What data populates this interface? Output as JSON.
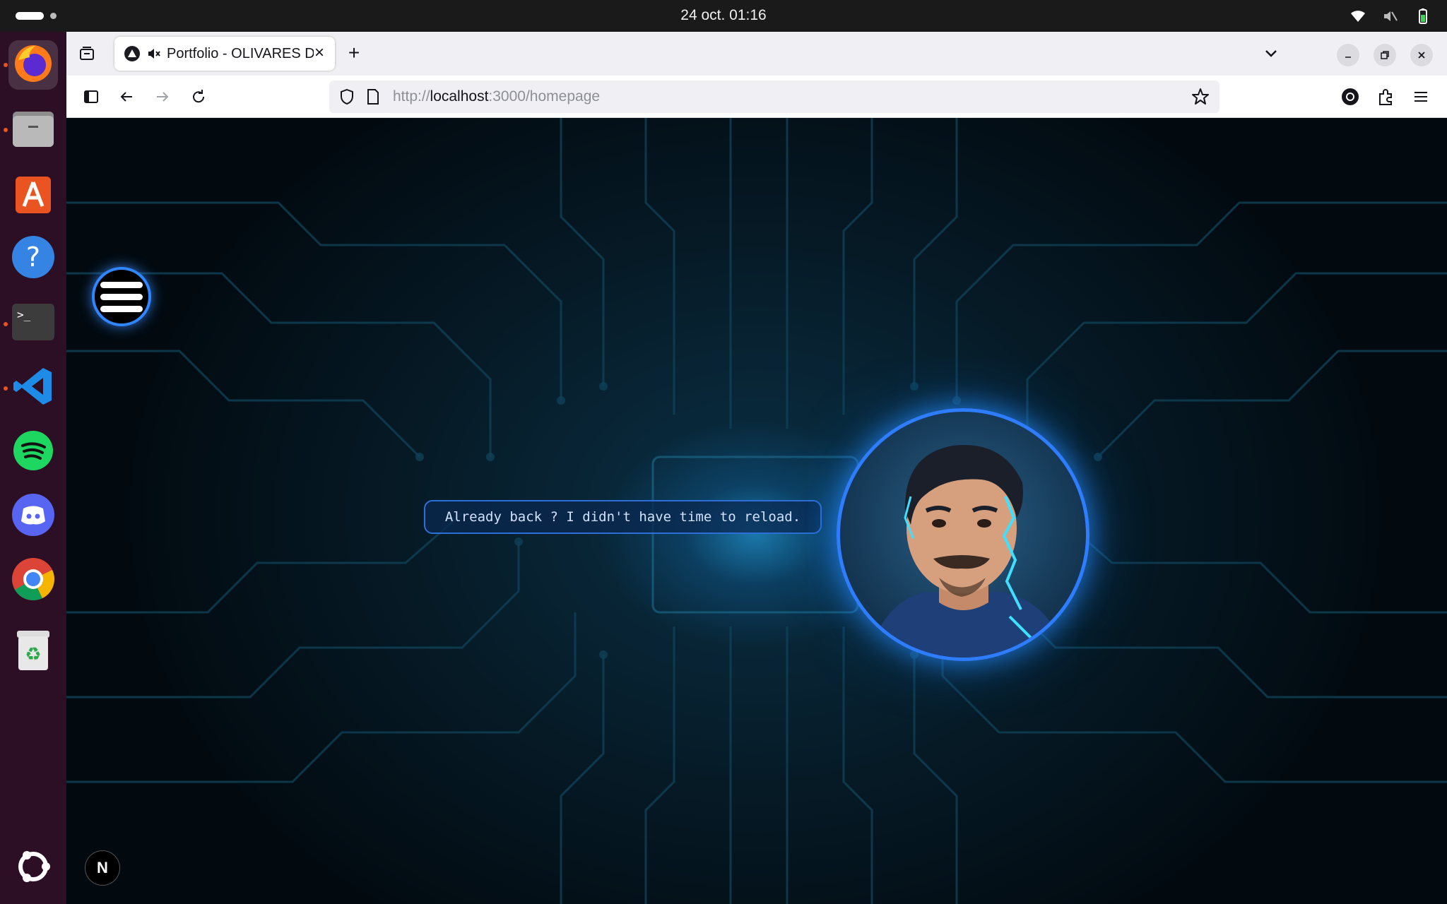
{
  "system": {
    "clock": "24 oct.  01:16",
    "icons": [
      "wifi-icon",
      "volume-muted-icon",
      "battery-icon"
    ]
  },
  "dock": {
    "apps": [
      "firefox-icon",
      "files-icon",
      "app-center-icon",
      "help-icon",
      "terminal-icon",
      "vscode-icon",
      "spotify-icon",
      "discord-icon",
      "chrome-icon",
      "trash-icon",
      "ubuntu-logo-icon"
    ]
  },
  "browser": {
    "tab": {
      "title": "Portfolio - OLIVARES D",
      "close_label": "×"
    },
    "new_tab_label": "+",
    "url": {
      "scheme": "http://",
      "host": "localhost",
      "rest": ":3000/homepage"
    }
  },
  "page": {
    "speech_text": "Already back ? I didn't have time to reload.",
    "badge_label": "N"
  },
  "colors": {
    "accent_blue": "#2f7dff",
    "dock_bg": "#2c0f24",
    "page_bg": "#061a26"
  }
}
